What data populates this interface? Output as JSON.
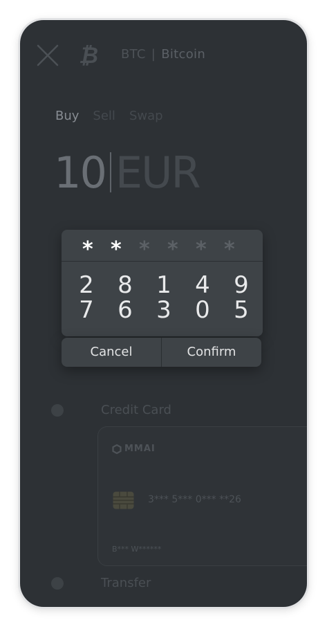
{
  "header": {
    "symbol": "BTC",
    "separator": "|",
    "name": "Bitcoin"
  },
  "tabs": [
    {
      "label": "Buy",
      "active": true
    },
    {
      "label": "Sell",
      "active": false
    },
    {
      "label": "Swap",
      "active": false
    }
  ],
  "amount": {
    "value": "10",
    "currency": "EUR"
  },
  "pin_dialog": {
    "dots": [
      "*",
      "*",
      "*",
      "*",
      "*",
      "*"
    ],
    "entered_count": 2,
    "keys": [
      "2",
      "8",
      "1",
      "4",
      "9",
      "7",
      "6",
      "3",
      "0",
      "5"
    ],
    "cancel_label": "Cancel",
    "confirm_label": "Confirm"
  },
  "payment_methods": [
    {
      "label": "Credit Card"
    },
    {
      "label": "Transfer"
    }
  ],
  "card": {
    "brand": "MMAI",
    "number": "3*** 5*** 0*** **26",
    "holder": "B*** W******"
  }
}
